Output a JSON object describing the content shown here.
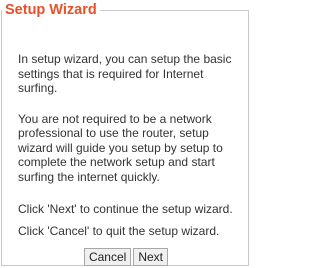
{
  "wizard": {
    "title": "Setup Wizard",
    "paragraphs": [
      "In setup wizard, you can setup the basic settings that is required for Internet surfing.",
      "You are not required to be a network professional to use the router, setup wizard will guide you setup by setup to complete the network setup and start surfing the internet quickly.",
      "Click 'Next' to continue the setup wizard.",
      "Click 'Cancel' to quit the setup wizard."
    ],
    "title_color": "#e8502a"
  },
  "buttons": {
    "cancel_label": "Cancel",
    "next_label": "Next"
  }
}
